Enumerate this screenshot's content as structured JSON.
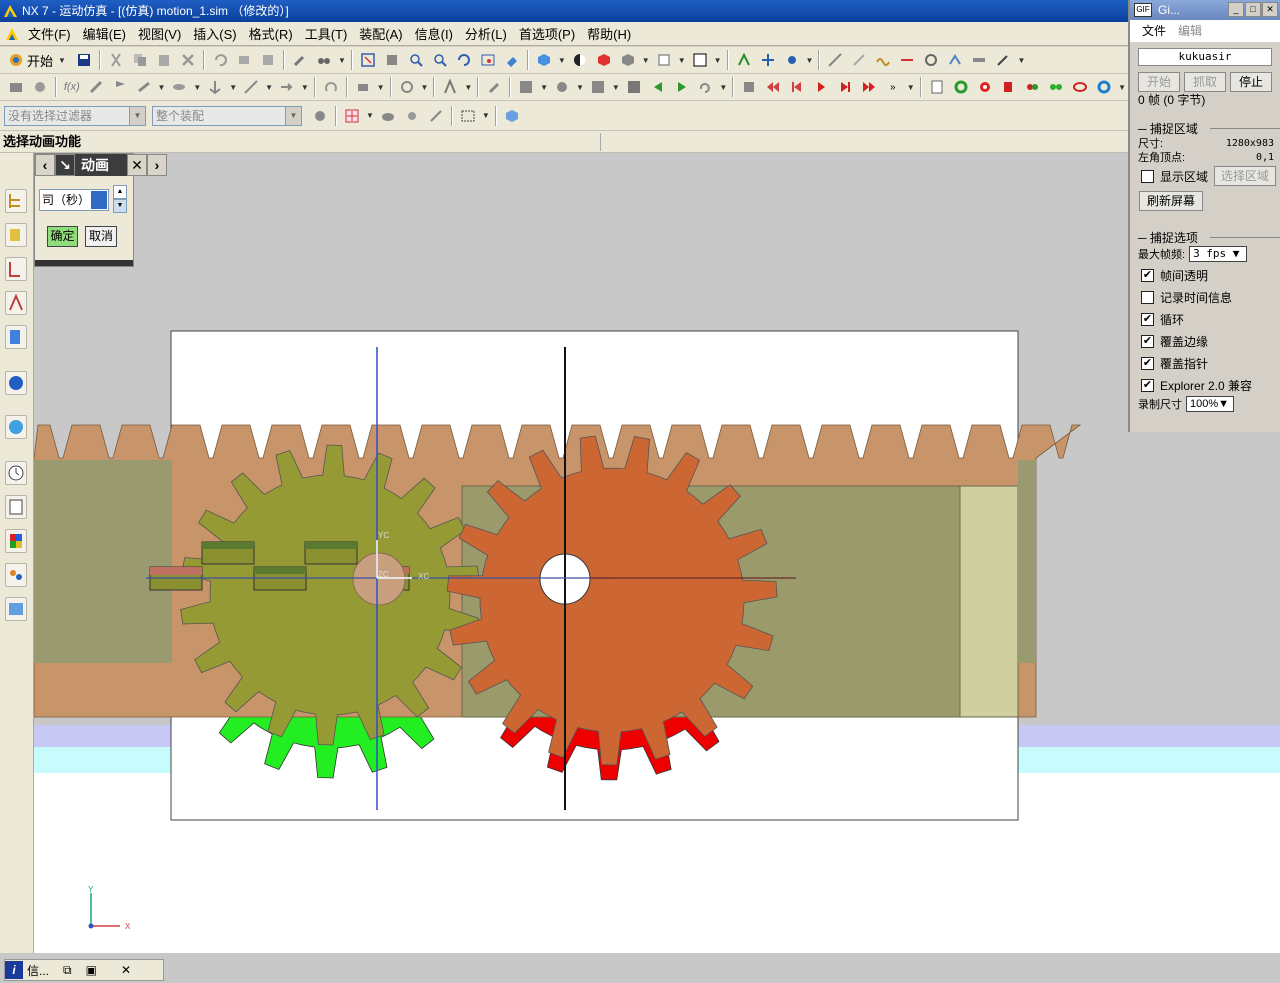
{
  "window": {
    "title": "NX 7 - 运动仿真 - [(仿真) motion_1.sim （修改的）]"
  },
  "menu": [
    "文件(F)",
    "编辑(E)",
    "视图(V)",
    "插入(S)",
    "格式(R)",
    "工具(T)",
    "装配(A)",
    "信息(I)",
    "分析(L)",
    "首选项(P)",
    "帮助(H)"
  ],
  "toolbar": {
    "start_label": "开始"
  },
  "filters": {
    "selection_filter": "没有选择过滤器",
    "assembly_scope": "整个装配"
  },
  "cue_line": "选择动画功能",
  "animation_dialog": {
    "title": "动画",
    "time_field": "司（秒）",
    "ok_label": "确定",
    "cancel_label": "取消"
  },
  "viewport": {
    "csys_labels": {
      "yc": "YC",
      "xc": "XC",
      "zc": "ZC"
    },
    "triad": {
      "x": "X",
      "y": "Y"
    },
    "colors": {
      "rack": "#c8956a",
      "pinion": "#969a34",
      "gear": "#cc6633",
      "pinion_shadow": "#22ee22",
      "gear_shadow": "#ee0000"
    }
  },
  "gif_recorder": {
    "title": "Gi...",
    "menu": [
      "文件",
      "编辑"
    ],
    "user": "kukuasir",
    "buttons": {
      "start": "开始",
      "grab": "抓取",
      "stop": "停止"
    },
    "frames_info": "0 帧 (0 字节)",
    "capture_region_label": "捕捉区域",
    "size_key": "尺寸:",
    "size_value": "1280x983",
    "topleft_key": "左角顶点:",
    "topleft_value": "0,1",
    "show_region": "显示区域",
    "select_region": "选择区域",
    "refresh": "刷新屏幕",
    "capture_options_label": "捕捉选项",
    "max_fps_label": "最大帧频:",
    "max_fps_value": "3 fps",
    "options": [
      {
        "label": "帧间透明",
        "checked": true
      },
      {
        "label": "记录时间信息",
        "checked": false
      },
      {
        "label": "循环",
        "checked": true
      },
      {
        "label": "覆盖边缘",
        "checked": true
      },
      {
        "label": "覆盖指针",
        "checked": true
      },
      {
        "label": "Explorer 2.0 兼容",
        "checked": true
      }
    ],
    "record_size_label": "录制尺寸",
    "record_size_value": "100%"
  },
  "taskbar": {
    "info_tab": "信..."
  }
}
